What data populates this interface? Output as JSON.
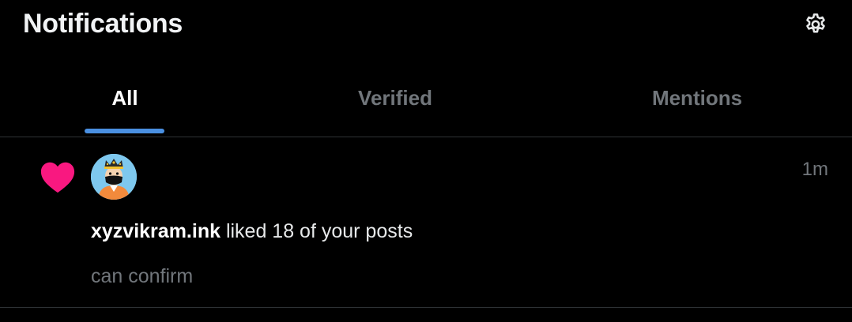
{
  "header": {
    "title": "Notifications",
    "settings_icon": "gear-icon"
  },
  "tabs": [
    {
      "label": "All",
      "active": true
    },
    {
      "label": "Verified",
      "active": false
    },
    {
      "label": "Mentions",
      "active": false
    }
  ],
  "notifications": [
    {
      "type_icon": "heart-icon",
      "avatar": "avatar",
      "timestamp": "1m",
      "username": "xyzvikram.ink",
      "action": " liked 18 of your posts",
      "preview": "can confirm"
    }
  ],
  "colors": {
    "background": "#000000",
    "accent": "#4a90e2",
    "heart": "#f91880",
    "muted_text": "#71767b",
    "divider": "#2f3336"
  }
}
